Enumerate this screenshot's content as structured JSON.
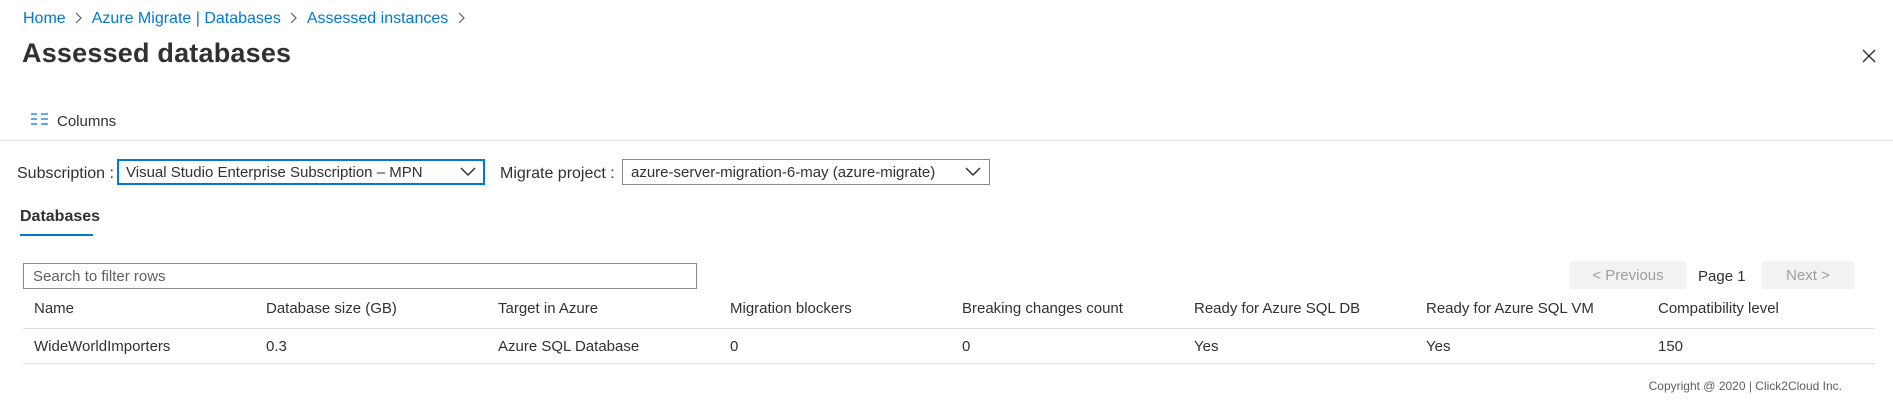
{
  "breadcrumb": {
    "items": [
      "Home",
      "Azure Migrate | Databases",
      "Assessed instances"
    ]
  },
  "header": {
    "title": "Assessed databases",
    "close_icon": "close-icon"
  },
  "toolbar": {
    "columns_label": "Columns",
    "columns_icon": "columns-icon"
  },
  "filters": {
    "subscription_label": "Subscription :",
    "subscription_value": "Visual Studio Enterprise Subscription – MPN",
    "project_label": "Migrate project :",
    "project_value": "azure-server-migration-6-may (azure-migrate)"
  },
  "tabs": [
    {
      "label": "Databases",
      "active": true
    }
  ],
  "search": {
    "placeholder": "Search to filter rows",
    "value": ""
  },
  "pager": {
    "previous_label": "< Previous",
    "page_label": "Page 1",
    "next_label": "Next >"
  },
  "table": {
    "columns": [
      "Name",
      "Database size (GB)",
      "Target in Azure",
      "Migration blockers",
      "Breaking changes count",
      "Ready for Azure SQL DB",
      "Ready for Azure SQL VM",
      "Compatibility level"
    ],
    "rows": [
      [
        "WideWorldImporters",
        "0.3",
        "Azure SQL Database",
        "0",
        "0",
        "Yes",
        "Yes",
        "150"
      ]
    ]
  },
  "footer": {
    "copyright": "Copyright @ 2020 |  Click2Cloud Inc."
  },
  "colors": {
    "accent": "#0078d4",
    "text": "#323130",
    "border": "#8a8886",
    "divider": "#e1dfdd",
    "disabled_bg": "#f3f2f1",
    "disabled_text": "#a19f9d"
  }
}
